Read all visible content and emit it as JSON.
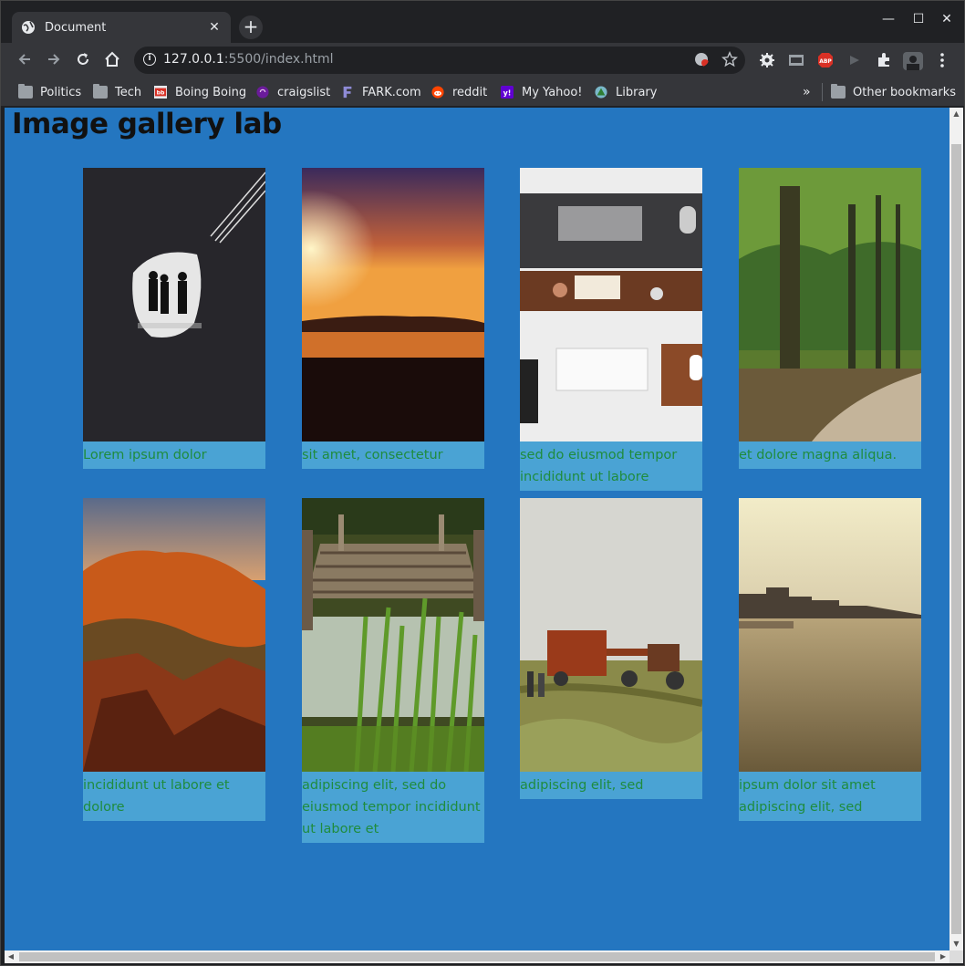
{
  "browser": {
    "tab_title": "Document",
    "tab_close": "✕",
    "new_tab": "+",
    "url_host": "127.0.0.1",
    "url_rest": ":5500/index.html",
    "window_controls": {
      "minimize": "—",
      "maximize": "☐",
      "close": "✕"
    },
    "more_bookmarks": "»",
    "bookmarks": [
      {
        "label": "Politics",
        "icon": "folder-icon"
      },
      {
        "label": "Tech",
        "icon": "folder-icon"
      },
      {
        "label": "Boing Boing",
        "icon": "boingboing-icon"
      },
      {
        "label": "craigslist",
        "icon": "craigslist-icon"
      },
      {
        "label": "FARK.com",
        "icon": "fark-icon"
      },
      {
        "label": "reddit",
        "icon": "reddit-icon"
      },
      {
        "label": "My Yahoo!",
        "icon": "yahoo-icon"
      },
      {
        "label": "Library",
        "icon": "library-icon"
      }
    ],
    "other_bookmarks": "Other bookmarks",
    "colors": {
      "frame": "#202124",
      "toolbar": "#35363a",
      "text": "#e8eaed"
    }
  },
  "page": {
    "title": "Image gallery lab",
    "background": "#2476c0",
    "caption_background": "#4aa3d4",
    "caption_color": "#1f8c3e",
    "gallery": [
      {
        "caption": "Lorem ipsum dolor",
        "scene": "tunnel-silhouettes"
      },
      {
        "caption": "sit amet, consectetur",
        "scene": "sunset-ocean"
      },
      {
        "caption": "sed do eiusmod tempor incididunt ut labore",
        "scene": "desk-keyboards"
      },
      {
        "caption": "et dolore magna aliqua.",
        "scene": "forest-path"
      },
      {
        "caption": "incididunt ut labore et dolore",
        "scene": "red-rocks"
      },
      {
        "caption": "adipiscing elit, sed do eiusmod tempor incididunt ut labore et",
        "scene": "old-dock"
      },
      {
        "caption": "adipiscing elit, sed",
        "scene": "hay-baler"
      },
      {
        "caption": "ipsum dolor sit amet adipiscing elit, sed",
        "scene": "river-city"
      }
    ]
  }
}
